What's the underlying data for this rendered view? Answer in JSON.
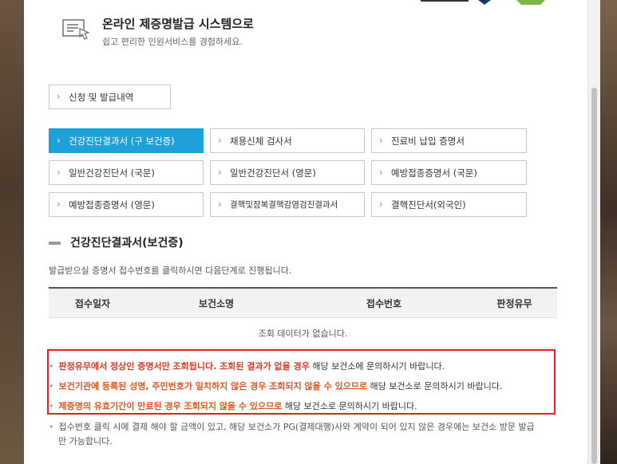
{
  "header": {
    "title": "온라인 제증명발급 시스템으로",
    "subtitle": "쉽고 편리한 민원서비스를 경험하세요."
  },
  "history_button": "신청 및 발급내역",
  "certificates": [
    {
      "label": "건강진단결과서 (구 보건증)",
      "active": true
    },
    {
      "label": "채용신체 검사서",
      "active": false
    },
    {
      "label": "진료비 납입 증명서",
      "active": false
    },
    {
      "label": "일반건강진단서 (국문)",
      "active": false
    },
    {
      "label": "일반건강진단서 (영문)",
      "active": false
    },
    {
      "label": "예방접종증명서 (국문)",
      "active": false
    },
    {
      "label": "예방접종증명서 (영문)",
      "active": false
    },
    {
      "label": "결핵및잠복결핵감염검진결과서",
      "active": false
    },
    {
      "label": "결핵진단서(외국인)",
      "active": false
    }
  ],
  "section": {
    "title": "건강진단결과서(보건증)",
    "description": "발급받으실 증명서 접수번호를 클릭하시면 다음단계로 진행됩니다."
  },
  "table": {
    "headers": [
      "접수일자",
      "보건소명",
      "접수번호",
      "판정유무"
    ],
    "empty_message": "조회 데이터가 없습니다."
  },
  "notices": [
    {
      "highlight": "판정유무에서 정상인 증명서만 조회됩니다. 조회된 결과가 없을 경우",
      "rest": " 해당 보건소에 문의하시기 바랍니다."
    },
    {
      "highlight": "보건기관에 등록된 성명, 주민번호가 일치하지 않은 경우 조회되지 않을 수 있으므로",
      "rest": " 해당 보건소로 문의하시기 바랍니다."
    },
    {
      "highlight": "제증명의 유효기간이 만료된 경우 조회되지 않을 수 있으므로",
      "rest": " 해당 보건소로 문의하시기 바랍니다."
    }
  ],
  "footer_note_line1": "접수번호 클릭 시에 결제 해야 할 금액이 있고, 해당 보건소가 PG(결제대행)사와 계약이 되어 있지 않은 경우에는 보건소 방문 발급",
  "footer_note_line2": "만 가능합니다.",
  "colors": {
    "active": "#1ea0d9",
    "alert_border": "#dd2222",
    "alert_text": "#d53a2a"
  }
}
